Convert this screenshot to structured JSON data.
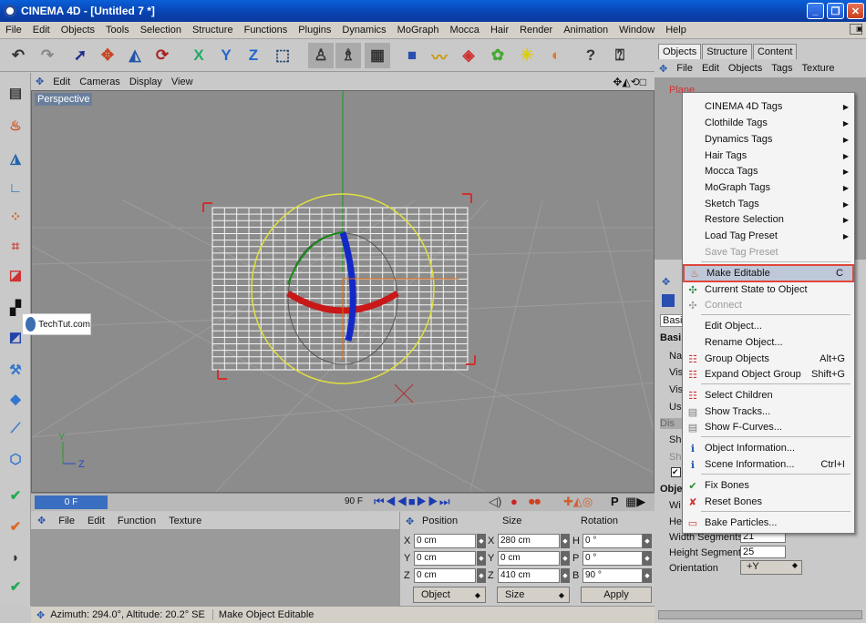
{
  "window": {
    "title": "CINEMA 4D - [Untitled 7 *]"
  },
  "menubar": [
    "File",
    "Edit",
    "Objects",
    "Tools",
    "Selection",
    "Structure",
    "Functions",
    "Plugins",
    "Dynamics",
    "MoGraph",
    "Mocca",
    "Hair",
    "Render",
    "Animation",
    "Window",
    "Help"
  ],
  "viewport": {
    "menu": [
      "Edit",
      "Cameras",
      "Display",
      "View"
    ],
    "label": "Perspective",
    "axis_y": "Y",
    "axis_z": "Z"
  },
  "timeline": {
    "current": "0 F",
    "end": "90 F"
  },
  "material_manager": {
    "menu": [
      "File",
      "Edit",
      "Function",
      "Texture"
    ]
  },
  "coordinates": {
    "headers": [
      "Position",
      "Size",
      "Rotation"
    ],
    "rows": [
      {
        "pos_axis": "X",
        "pos": "0 cm",
        "size_axis": "X",
        "size": "280 cm",
        "rot_axis": "H",
        "rot": "0 °"
      },
      {
        "pos_axis": "Y",
        "pos": "0 cm",
        "size_axis": "Y",
        "size": "0 cm",
        "rot_axis": "P",
        "rot": "0 °"
      },
      {
        "pos_axis": "Z",
        "pos": "0 cm",
        "size_axis": "Z",
        "size": "410 cm",
        "rot_axis": "B",
        "rot": "90 °"
      }
    ],
    "mode": "Object",
    "size_mode": "Size",
    "apply": "Apply"
  },
  "status": {
    "azimuth": "Azimuth: 294.0°, Altitude: 20.2°  SE",
    "message": "Make Object Editable"
  },
  "right_panel": {
    "tabs": [
      "Objects",
      "Structure",
      "Content"
    ],
    "menu": [
      "File",
      "Edit",
      "Objects",
      "Tags",
      "Texture"
    ],
    "object_name": "Plane",
    "attributes": {
      "tab_basic": "Basi",
      "section_basic": "Basi",
      "rows_basic": [
        "Na",
        "Vis",
        "Vis",
        "Us",
        "Dis",
        "Sh",
        "Sh"
      ],
      "section_object": "Obje",
      "rows_object": [
        {
          "label": "Wi",
          "value": ""
        },
        {
          "label": "He",
          "value": ""
        },
        {
          "label": "Width Segments",
          "value": "21"
        },
        {
          "label": "Height Segments",
          "value": "25"
        },
        {
          "label": "Orientation",
          "value": "+Y"
        }
      ]
    }
  },
  "context_menu": {
    "items": [
      {
        "label": "CINEMA 4D Tags",
        "submenu": true
      },
      {
        "label": "Clothilde Tags",
        "submenu": true
      },
      {
        "label": "Dynamics Tags",
        "submenu": true
      },
      {
        "label": "Hair Tags",
        "submenu": true
      },
      {
        "label": "Mocca Tags",
        "submenu": true
      },
      {
        "label": "MoGraph Tags",
        "submenu": true
      },
      {
        "label": "Sketch Tags",
        "submenu": true
      },
      {
        "label": "Restore Selection",
        "submenu": true
      },
      {
        "label": "Load Tag Preset",
        "submenu": true
      },
      {
        "label": "Save Tag Preset",
        "disabled": true
      },
      {
        "label": "Make Editable",
        "shortcut": "C",
        "highlighted": true
      },
      {
        "label": "Current State to Object"
      },
      {
        "label": "Connect",
        "disabled": true
      },
      {
        "label": "Edit Object..."
      },
      {
        "label": "Rename Object..."
      },
      {
        "label": "Group Objects",
        "shortcut": "Alt+G"
      },
      {
        "label": "Expand Object Group",
        "shortcut": "Shift+G"
      },
      {
        "label": "Select Children"
      },
      {
        "label": "Show Tracks..."
      },
      {
        "label": "Show F-Curves..."
      },
      {
        "label": "Object Information..."
      },
      {
        "label": "Scene Information...",
        "shortcut": "Ctrl+I"
      },
      {
        "label": "Fix Bones"
      },
      {
        "label": "Reset Bones"
      },
      {
        "label": "Bake Particles..."
      }
    ]
  },
  "watermark": "TechTut.com",
  "colors": {
    "title_bar": "#0842b0",
    "highlight": "#e0463c",
    "menu_bg": "#f4f4f4",
    "viewport_bg": "#8c8c8c"
  }
}
